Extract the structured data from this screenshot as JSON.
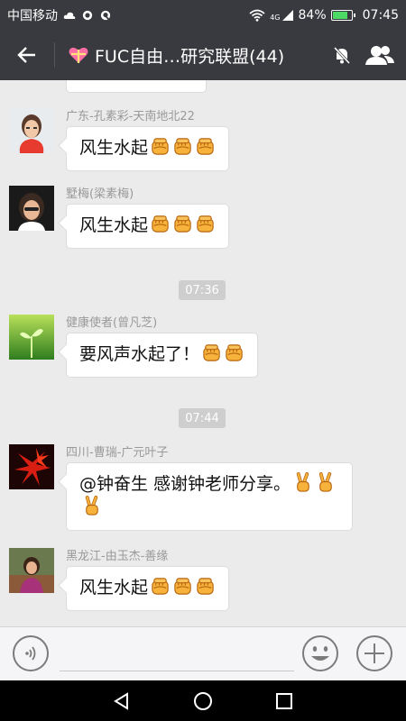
{
  "status_bar": {
    "carrier": "中国移动",
    "network": "4G",
    "battery": "84%",
    "battery_level": 0.84,
    "time": "07:45"
  },
  "header": {
    "title": "FUC自由…研究联盟(44)",
    "icons": [
      "back-arrow-icon",
      "heart-gift-icon",
      "mute-bell-icon",
      "group-members-icon"
    ]
  },
  "messages": [
    {
      "sender": "广东-孔素彩-天南地北22",
      "text": "风生水起",
      "emoji": [
        "fist",
        "fist",
        "fist"
      ]
    },
    {
      "sender": "墅梅(梁素梅)",
      "text": "风生水起",
      "emoji": [
        "fist",
        "fist",
        "fist"
      ]
    },
    {
      "time": "07:36"
    },
    {
      "sender": "健康使者(曾凡芝)",
      "text": "要风声水起了！",
      "emoji": [
        "fist",
        "fist"
      ]
    },
    {
      "time": "07:44"
    },
    {
      "sender": "四川-曹瑞-广元叶子",
      "text": "@钟奋生 感谢钟老师分享。",
      "emoji": [
        "victory",
        "victory",
        "victory"
      ]
    },
    {
      "sender": "黑龙江-由玉杰-善缘",
      "text": "风生水起",
      "emoji": [
        "fist",
        "fist",
        "fist"
      ]
    }
  ],
  "colors": {
    "header_bg": "#393a3f",
    "chat_bg": "#ebebeb",
    "bubble_bg": "#ffffff",
    "time_chip_bg": "#cecece"
  }
}
